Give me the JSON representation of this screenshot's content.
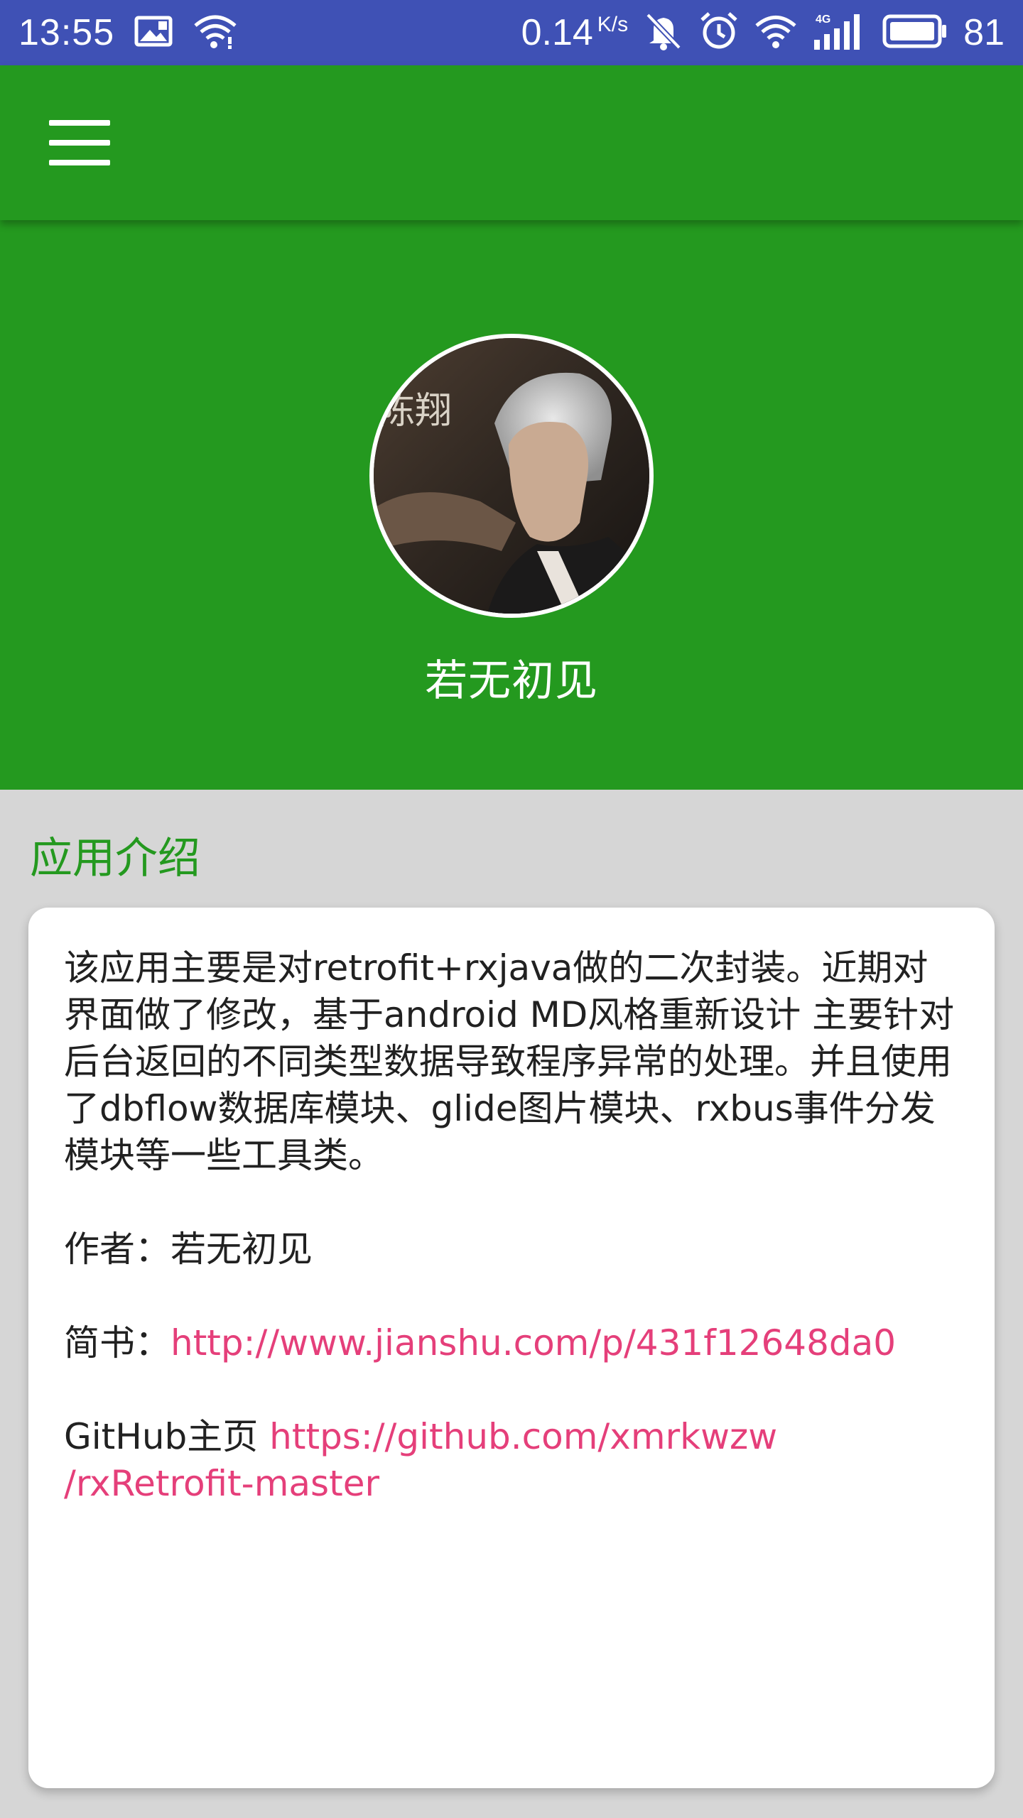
{
  "status_bar": {
    "time": "13:55",
    "net_speed": "0.14",
    "net_speed_unit": "K/s",
    "network_type": "4G",
    "battery_percent": "81",
    "icons": [
      "image-icon",
      "wifi-icon",
      "speed-icon",
      "mute-icon",
      "alarm-icon",
      "wifi-icon",
      "signal-icon",
      "battery-icon"
    ]
  },
  "app_bar": {
    "menu_icon": "hamburger-menu-icon"
  },
  "profile": {
    "name": "若无初见",
    "avatar_text": "陈翔"
  },
  "section": {
    "title": "应用介绍"
  },
  "intro": {
    "description": "该应用主要是对retrofit+rxjava做的二次封装。近期对界面做了修改，基于android MD风格重新设计 主要针对后台返回的不同类型数据导致程序异常的处理。并且使用了dbflow数据库模块、glide图片模块、rxbus事件分发模块等一些工具类。",
    "author_label": "作者：",
    "author_name": "若无初见",
    "jianshu_label": "简书：",
    "jianshu_url": "http://www.jianshu.com/p/431f12648da0",
    "github_label": "GitHub主页 ",
    "github_url_line1": "https://github.com/xmrkwzw",
    "github_url_line2": "/rxRetrofit-master"
  },
  "colors": {
    "status_bar": "#3f51b5",
    "primary": "#24991f",
    "accent_link": "#e53f7a",
    "background": "#d6d6d6",
    "card": "#ffffff",
    "text": "#212121"
  }
}
